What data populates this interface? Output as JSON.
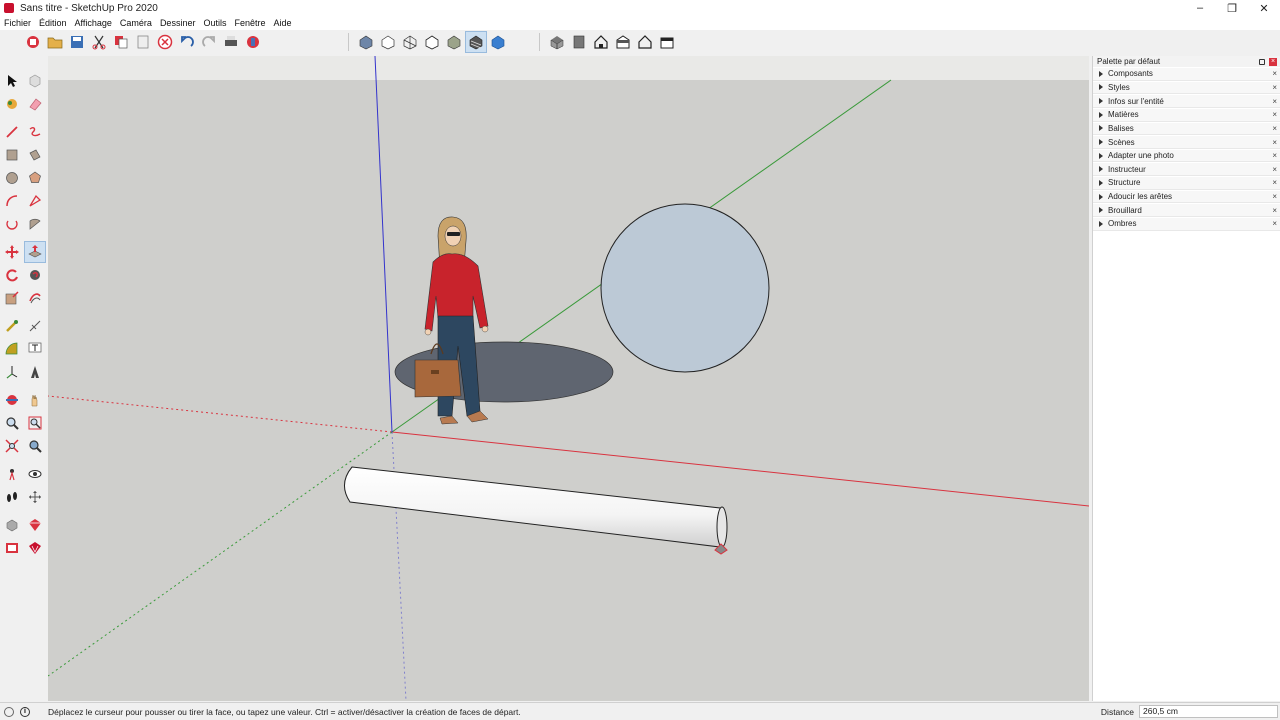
{
  "window": {
    "title": "Sans titre - SketchUp Pro 2020",
    "minimize": "–",
    "restore": "❐",
    "close": "✕"
  },
  "menu": {
    "items": [
      "Fichier",
      "Édition",
      "Affichage",
      "Caméra",
      "Dessiner",
      "Outils",
      "Fenêtre",
      "Aide"
    ]
  },
  "tray": {
    "title": "Palette par défaut",
    "items": [
      {
        "label": "Composants"
      },
      {
        "label": "Styles"
      },
      {
        "label": "Infos sur l'entité"
      },
      {
        "label": "Matières"
      },
      {
        "label": "Balises"
      },
      {
        "label": "Scènes"
      },
      {
        "label": "Adapter une photo"
      },
      {
        "label": "Instructeur"
      },
      {
        "label": "Structure"
      },
      {
        "label": "Adoucir les arêtes"
      },
      {
        "label": "Brouillard"
      },
      {
        "label": "Ombres"
      }
    ]
  },
  "status": {
    "message": "Déplacez le curseur pour pousser ou tirer la face, ou tapez une valeur.  Ctrl = activer/désactiver la création de faces de départ.",
    "measure_label": "Distance",
    "measure_value": "260,5 cm"
  },
  "colors": {
    "viewport": "#cfcfcc",
    "axis_red": "#d9333f",
    "axis_green": "#3a9a3a",
    "axis_blue": "#3333cc",
    "circle_fill": "#bcc9d6",
    "shadow": "#5f6570"
  }
}
